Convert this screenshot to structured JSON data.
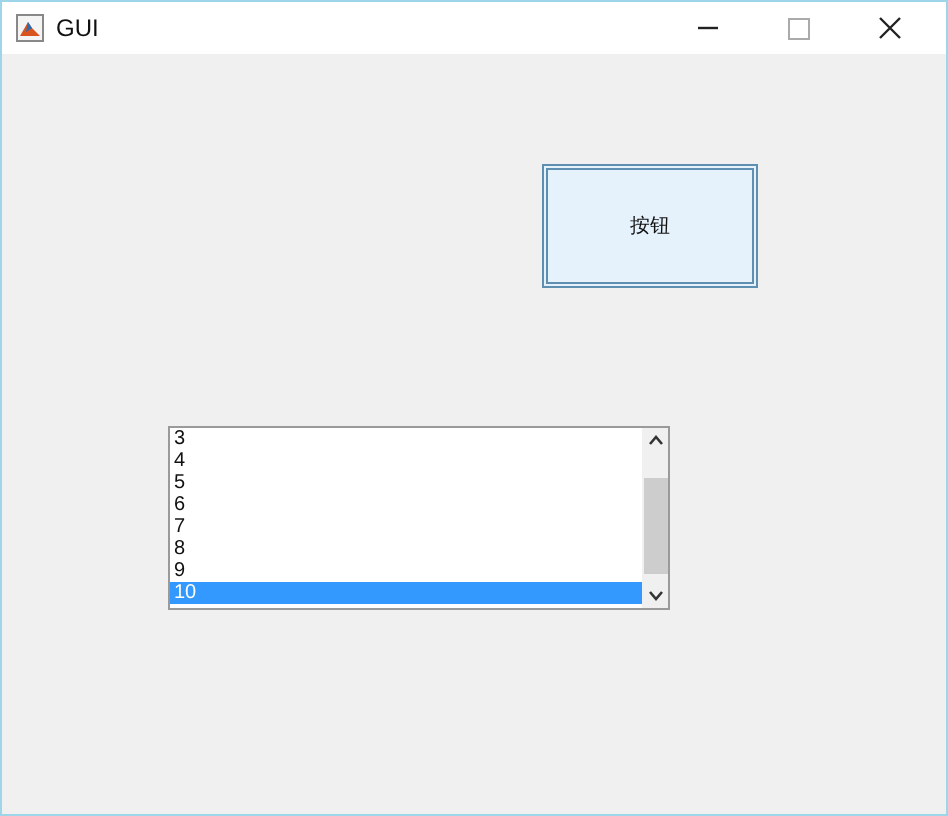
{
  "window": {
    "title": "GUI"
  },
  "button": {
    "label": "按钮"
  },
  "listbox": {
    "items": [
      {
        "label": "3",
        "selected": false
      },
      {
        "label": "4",
        "selected": false
      },
      {
        "label": "5",
        "selected": false
      },
      {
        "label": "6",
        "selected": false
      },
      {
        "label": "7",
        "selected": false
      },
      {
        "label": "8",
        "selected": false
      },
      {
        "label": "9",
        "selected": false
      },
      {
        "label": "10",
        "selected": true
      }
    ]
  }
}
